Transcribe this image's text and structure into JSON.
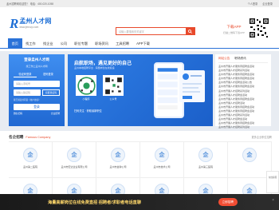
{
  "topbar": {
    "left": "孟州招聘网欢迎您！ 电话：400-020-1058",
    "account": "个人登录",
    "corp": "企业登录"
  },
  "logo": {
    "mark": "R",
    "name": "孟州人才网",
    "url": "www.jmrczp.com"
  },
  "search": {
    "placeholder": "请输入要搜索的关键字"
  },
  "download": {
    "label": "下载APP",
    "sub": "扫描二维码下载APP"
  },
  "nav": {
    "items": [
      {
        "label": "首页",
        "active": true
      },
      {
        "label": "找工作"
      },
      {
        "label": "找企业"
      },
      {
        "label": "公司"
      },
      {
        "label": "职位专题"
      },
      {
        "label": "职场资讯"
      },
      {
        "label": "工具招聘"
      },
      {
        "label": "APP下载"
      }
    ]
  },
  "login": {
    "title": "登录孟州人才网",
    "subtitle": "找工作上孟州人才网",
    "tab_sms": "验证码登录",
    "tab_pwd": "密码登录",
    "phone_ph": "请输入手机号",
    "code_ph": "请输入验证码",
    "code_btn": "获取验证码",
    "agree": "我已阅读并同意《用户协议》",
    "submit": "登录",
    "alt_left": "微信扫码",
    "alt_right": "企业招聘"
  },
  "banner": {
    "headline": "启航职场，遇见更好的自己",
    "sub": "孟州本地招聘平台 · 海量岗位在线投递",
    "cap1": "小程序",
    "cap2": "公众号",
    "foot": "扫码关注 · 获取最新职位"
  },
  "notice": {
    "tab1": "网站公告",
    "tab2": "职场资讯",
    "items": [
      "孟州市开展人才服务周招聘会活动",
      "孟州市开展人才招聘系列活动",
      "孟州市开展人才服务周招聘会活动",
      "孟州市开展人才服务周招聘会活动",
      "孟州市开展人才招聘会活动公告",
      "孟州市开展人才服务周招聘会活动",
      "孟州市开展人才招聘系列活动",
      "孟州市开展人才招聘会活动",
      "孟州市开展人才服务周招聘会活动",
      "孟州市开展人才招聘活动",
      "孟州市开展人才服务周招聘会活动",
      "孟州市开展人才服务周招聘会活动",
      "孟州市开展人才招聘系列活动",
      "孟州市开展人才招聘会活动",
      "孟州市开展人才服务周招聘会活动",
      "孟州市开展人才招聘系列活动"
    ]
  },
  "companies": {
    "title": "名企招聘",
    "title_en": "Famous Company",
    "more": "更多企业职位招聘",
    "items": [
      {
        "name": "孟州第二医院"
      },
      {
        "name": "孟州市宏达企业有限公司"
      },
      {
        "name": "孟州市金钟公司"
      },
      {
        "name": "孟州市技术公司"
      },
      {
        "name": "孟州第三医院"
      },
      {
        "name": ""
      },
      {
        "name": ""
      },
      {
        "name": ""
      },
      {
        "name": ""
      },
      {
        "name": ""
      },
      {
        "name": ""
      },
      {
        "name": ""
      }
    ]
  },
  "bottombar": {
    "text": "海量高薪岗位在线免费直招 招聘者/求职者电话直聊",
    "button": "立即招聘"
  },
  "side": {
    "label": "在线客服"
  }
}
